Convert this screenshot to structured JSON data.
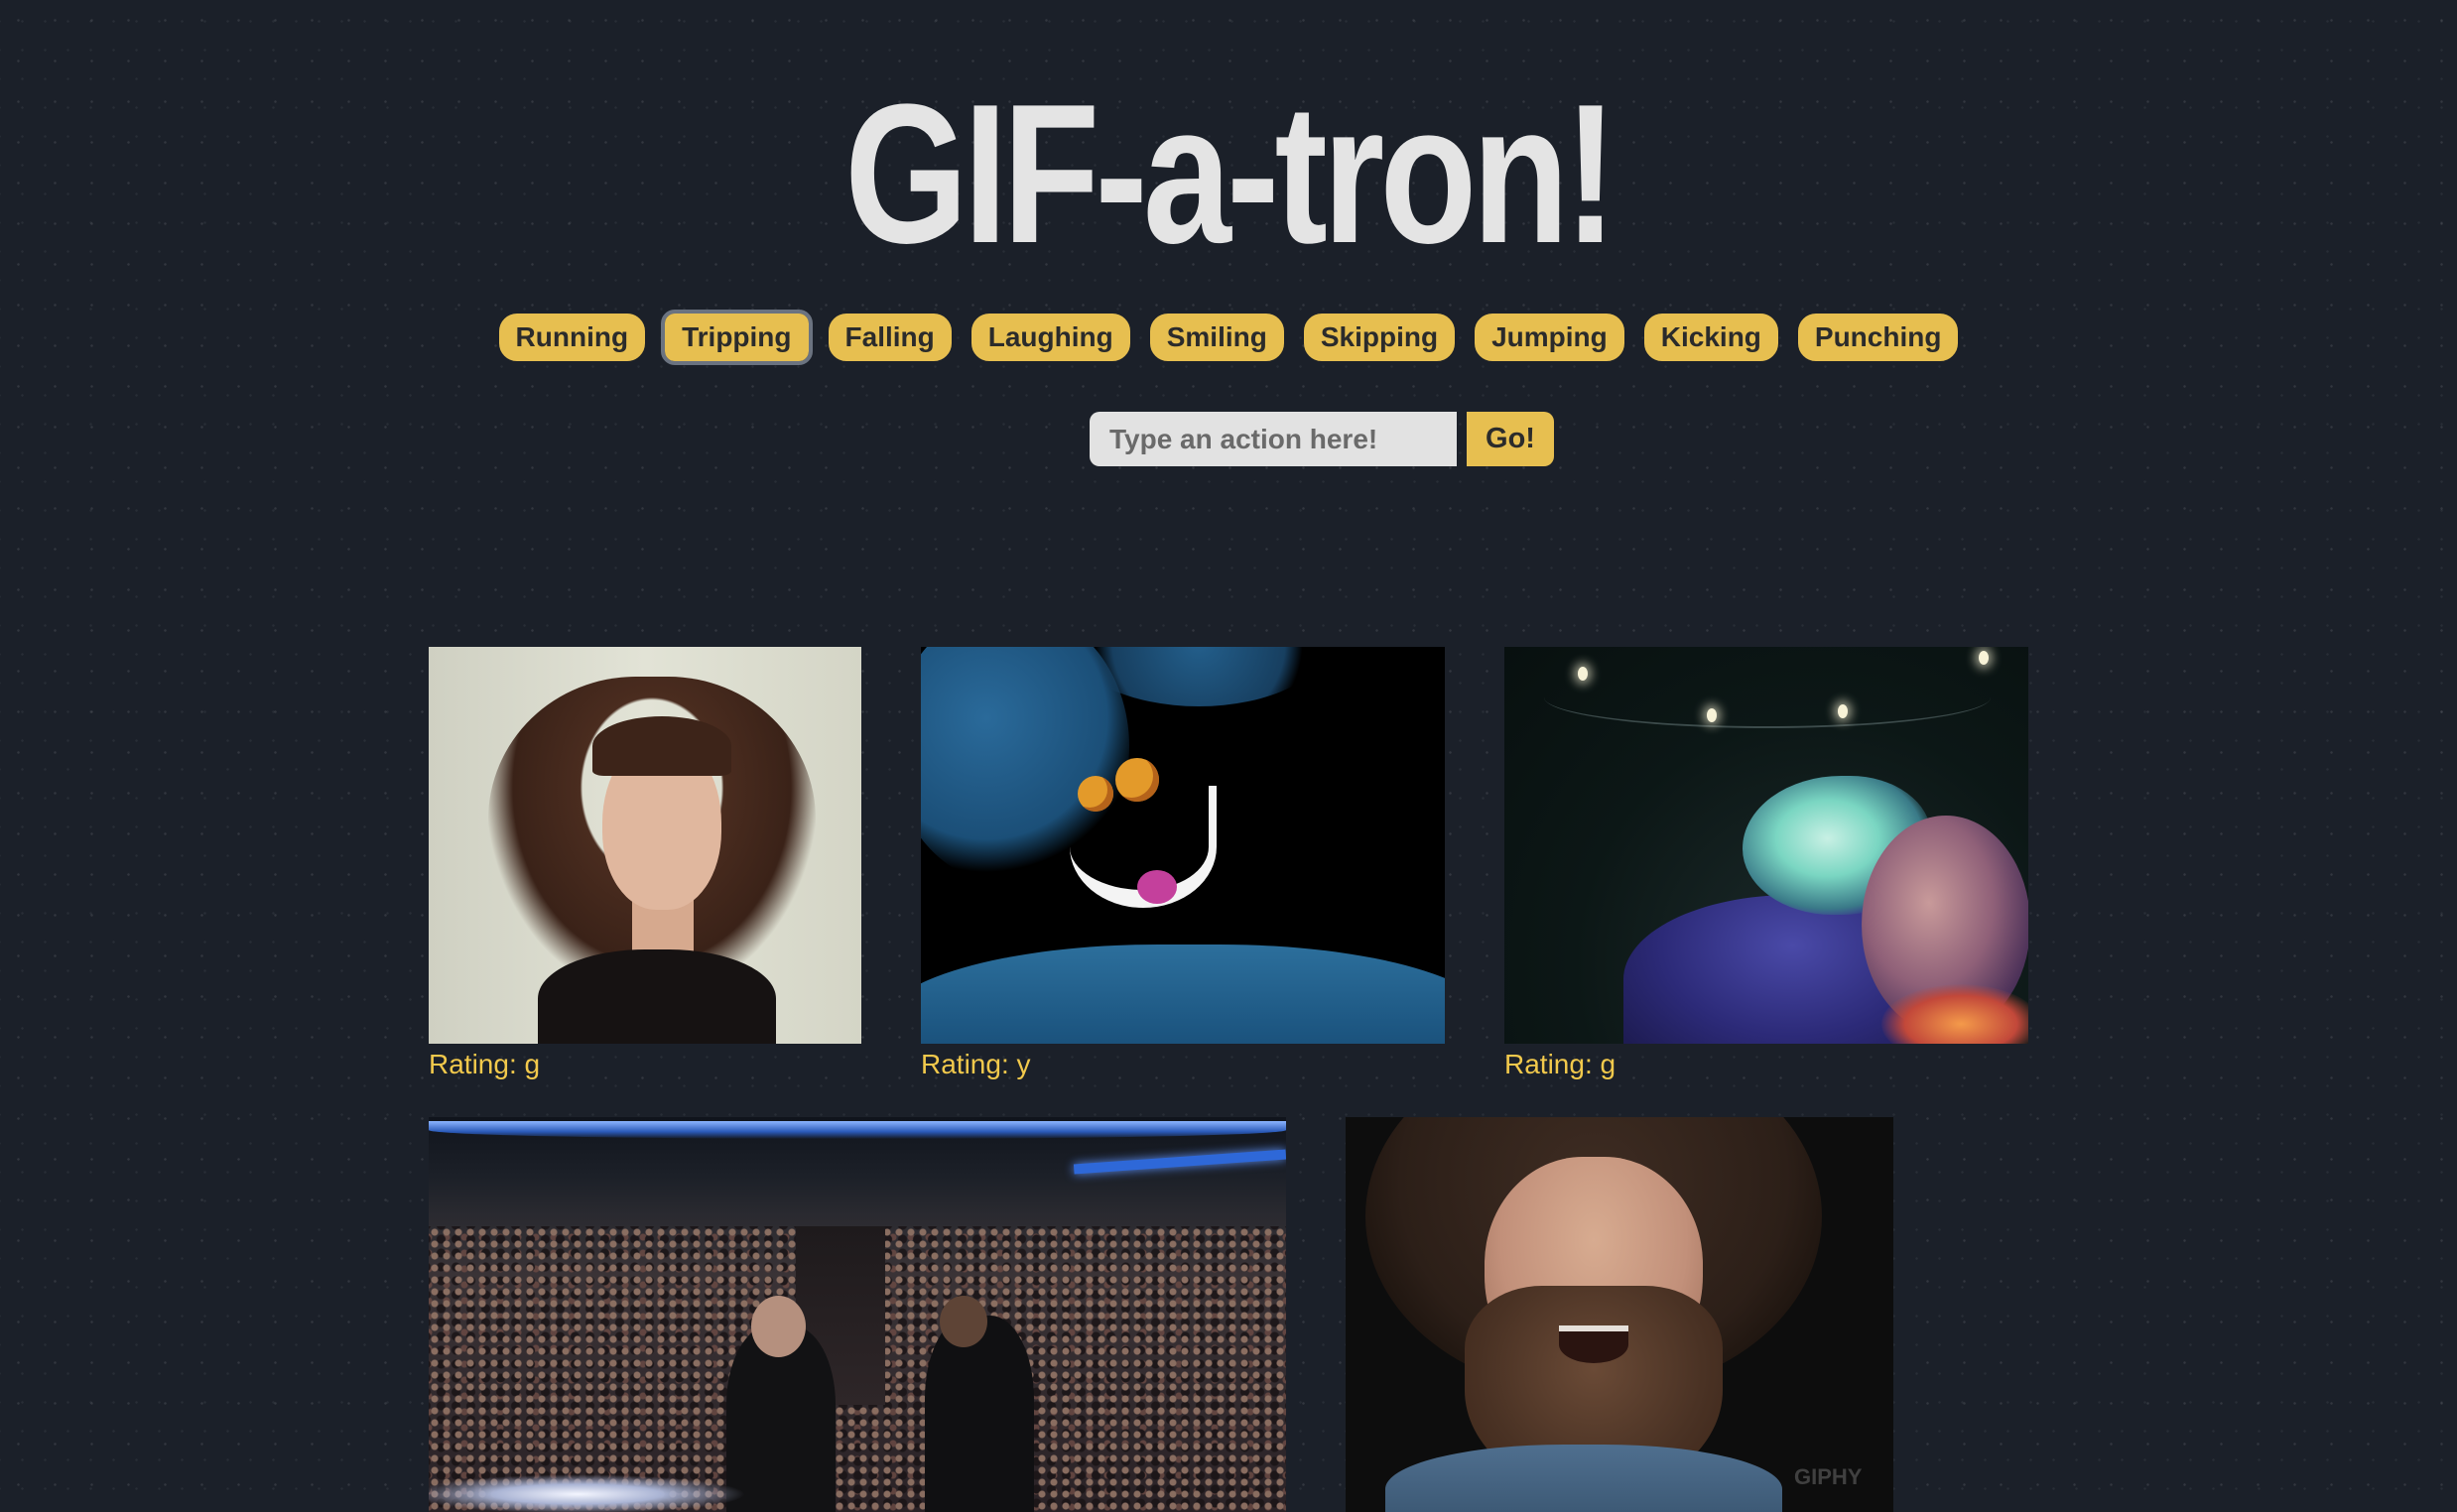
{
  "header": {
    "title": "GIF-a-tron!"
  },
  "actions": [
    {
      "label": "Running",
      "active": false
    },
    {
      "label": "Tripping",
      "active": true
    },
    {
      "label": "Falling",
      "active": false
    },
    {
      "label": "Laughing",
      "active": false
    },
    {
      "label": "Smiling",
      "active": false
    },
    {
      "label": "Skipping",
      "active": false
    },
    {
      "label": "Jumping",
      "active": false
    },
    {
      "label": "Kicking",
      "active": false
    },
    {
      "label": "Punching",
      "active": false
    }
  ],
  "search": {
    "placeholder": "Type an action here!",
    "value": "",
    "submit_label": "Go!"
  },
  "gifs": [
    {
      "rating": "Rating: g"
    },
    {
      "rating": "Rating: y"
    },
    {
      "rating": "Rating: g"
    },
    {
      "rating": ""
    },
    {
      "rating": "",
      "watermark": "GIPHY"
    }
  ],
  "colors": {
    "background": "#1b2029",
    "accent": "#e7bf50",
    "rating_text": "#f2c94c",
    "title_text": "#e4e4e4"
  }
}
